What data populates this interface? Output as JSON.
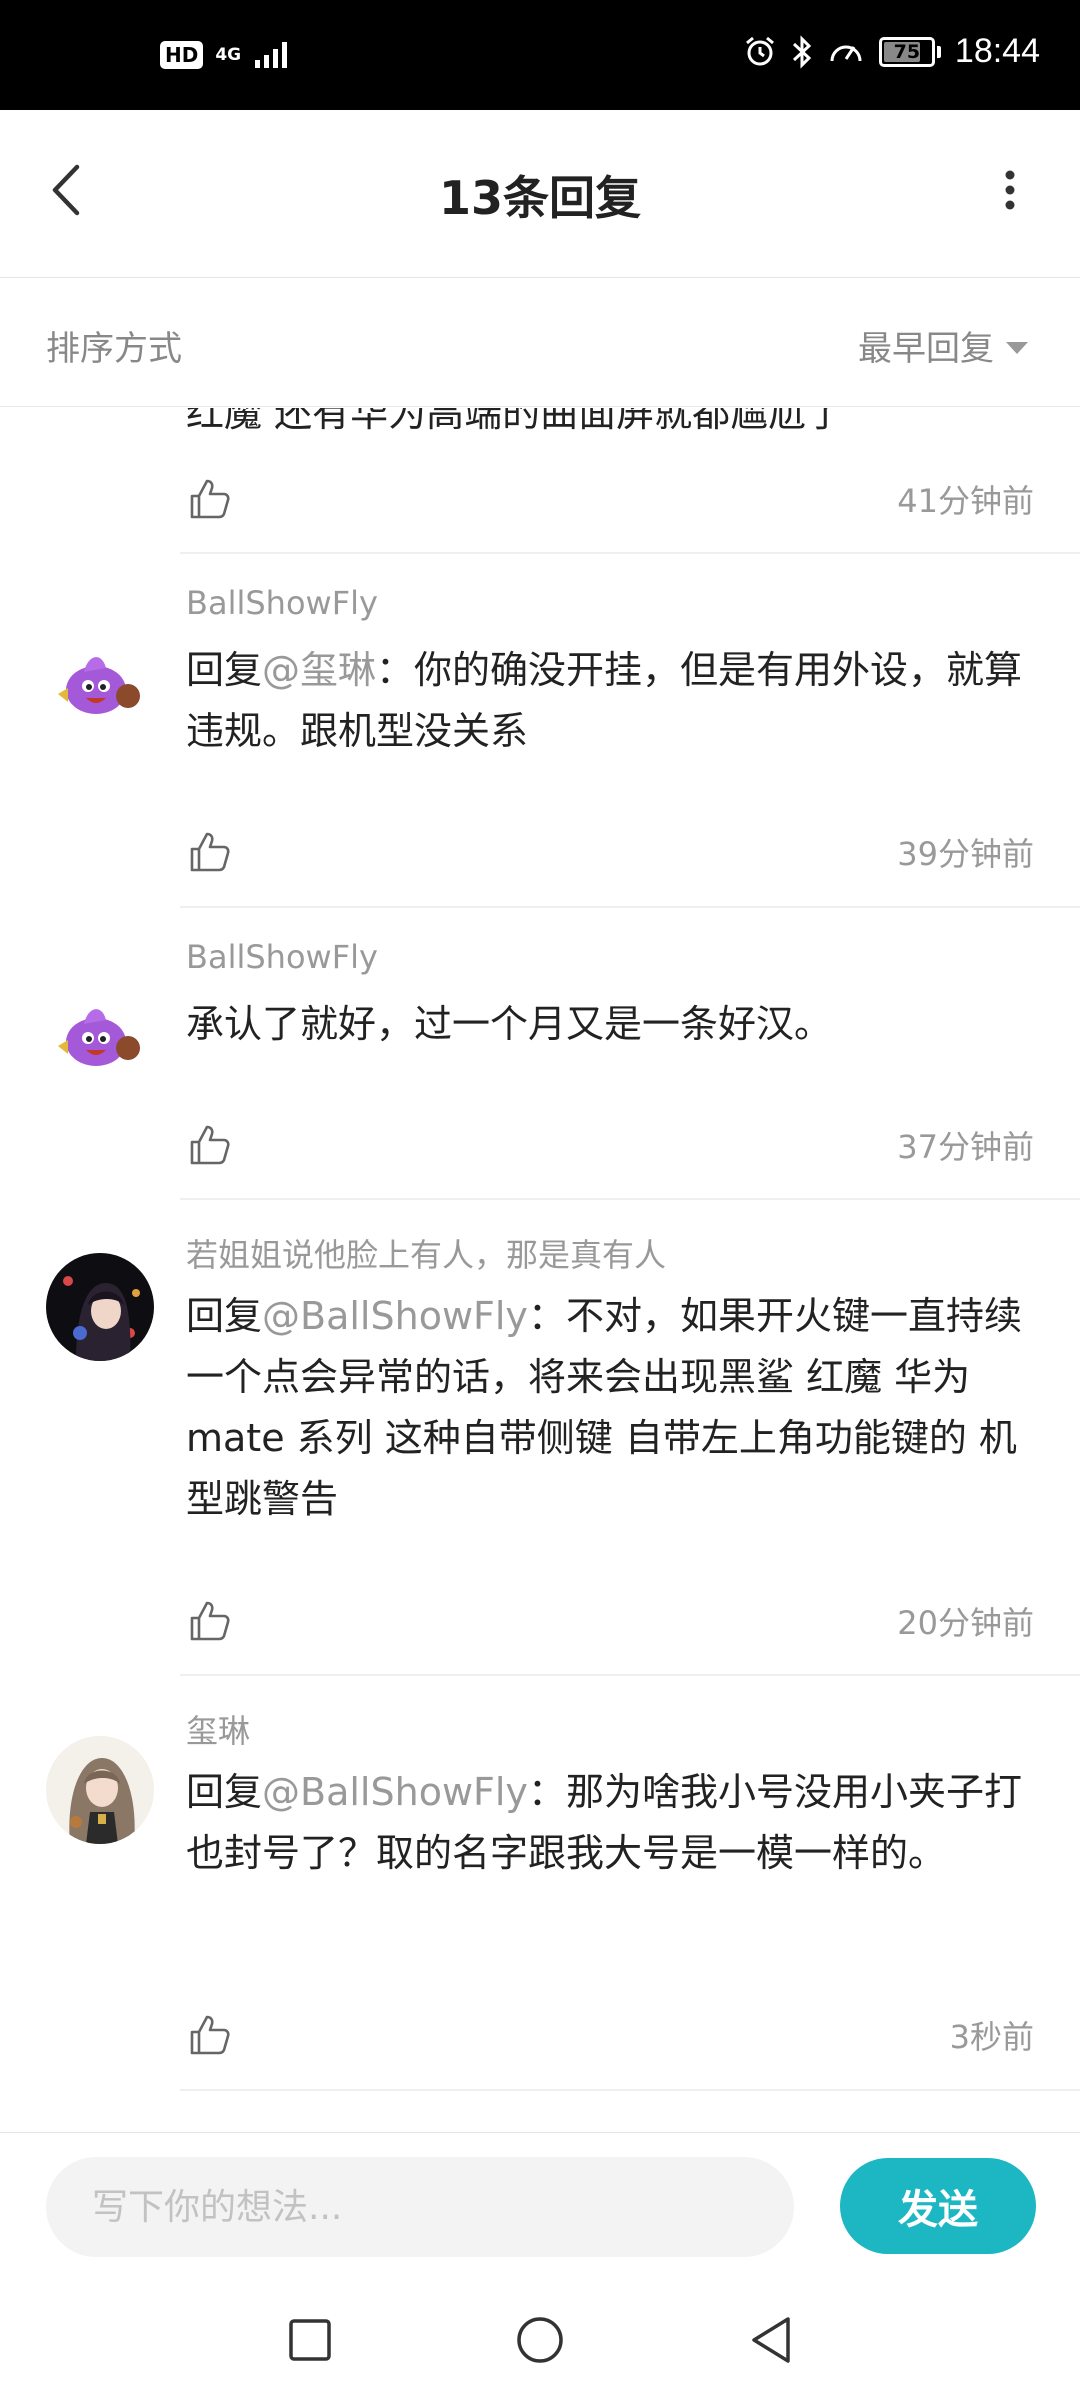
{
  "status_bar": {
    "hd": "HD",
    "network": "4G",
    "battery": "75",
    "time": "18:44"
  },
  "header": {
    "title": "13条回复"
  },
  "sort": {
    "label": "排序方式",
    "selected": "最早回复"
  },
  "partial_comment": {
    "text_tail": "红魔 还有华为高端的曲面屏就都尴尬了",
    "time": "41分钟前"
  },
  "comments": [
    {
      "username": "BallShowFly",
      "prefix": "回复",
      "mention": "@玺琳",
      "text": "：你的确没开挂，但是有用外设，就算违规。跟机型没关系",
      "time": "39分钟前"
    },
    {
      "username": "BallShowFly",
      "prefix": "",
      "mention": "",
      "text": "承认了就好，过一个月又是一条好汉。",
      "time": "37分钟前"
    },
    {
      "username": "若姐姐说他脸上有人，那是真有人",
      "prefix": "回复",
      "mention": "@BallShowFly",
      "text": "：不对，如果开火键一直持续一个点会异常的话，将来会出现黑鲨 红魔 华为mate 系列 这种自带侧键 自带左上角功能键的 机型跳警告",
      "time": "20分钟前"
    },
    {
      "username": "玺琳",
      "prefix": "回复",
      "mention": "@BallShowFly",
      "text": "：那为啥我小号没用小夹子打也封号了？取的名字跟我大号是一模一样的。",
      "time": "3秒前"
    }
  ],
  "input": {
    "placeholder": "写下你的想法..."
  },
  "send_label": "发送",
  "colors": {
    "accent": "#1cb7c3",
    "muted_text": "#999999",
    "primary_text": "#222222"
  },
  "icons": [
    "back-arrow-icon",
    "more-vertical-icon",
    "sort-caret-icon",
    "thumbs-up-icon",
    "nav-square-icon",
    "nav-circle-icon",
    "nav-triangle-icon"
  ]
}
